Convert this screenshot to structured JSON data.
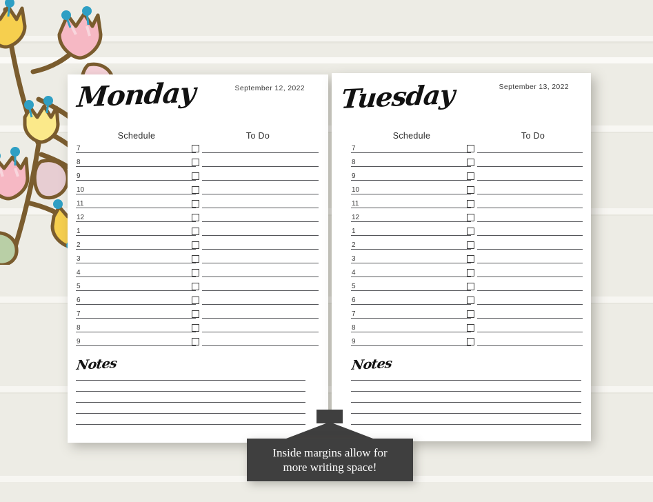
{
  "background": {
    "color": "#edece5",
    "stripe_color": "#f7f6f2",
    "decoration": "floral-tulips-illustration"
  },
  "pages": [
    {
      "id": "monday",
      "day_label": "Monday",
      "date": "September 12, 2022",
      "schedule_header": "Schedule",
      "todo_header": "To Do",
      "hours": [
        "7",
        "8",
        "9",
        "10",
        "11",
        "12",
        "1",
        "2",
        "3",
        "4",
        "5",
        "6",
        "7",
        "8",
        "9"
      ],
      "todo_count": 15,
      "notes_label": "Notes",
      "notes_line_count": 5
    },
    {
      "id": "tuesday",
      "day_label": "Tuesday",
      "date": "September 13, 2022",
      "schedule_header": "Schedule",
      "todo_header": "To Do",
      "hours": [
        "7",
        "8",
        "9",
        "10",
        "11",
        "12",
        "1",
        "2",
        "3",
        "4",
        "5",
        "6",
        "7",
        "8",
        "9"
      ],
      "todo_count": 15,
      "notes_label": "Notes",
      "notes_line_count": 5
    }
  ],
  "callout": {
    "line1": "Inside margins allow for",
    "line2": "more writing space!",
    "background_color": "#3f3f3f",
    "text_color": "#fdfdfd"
  }
}
